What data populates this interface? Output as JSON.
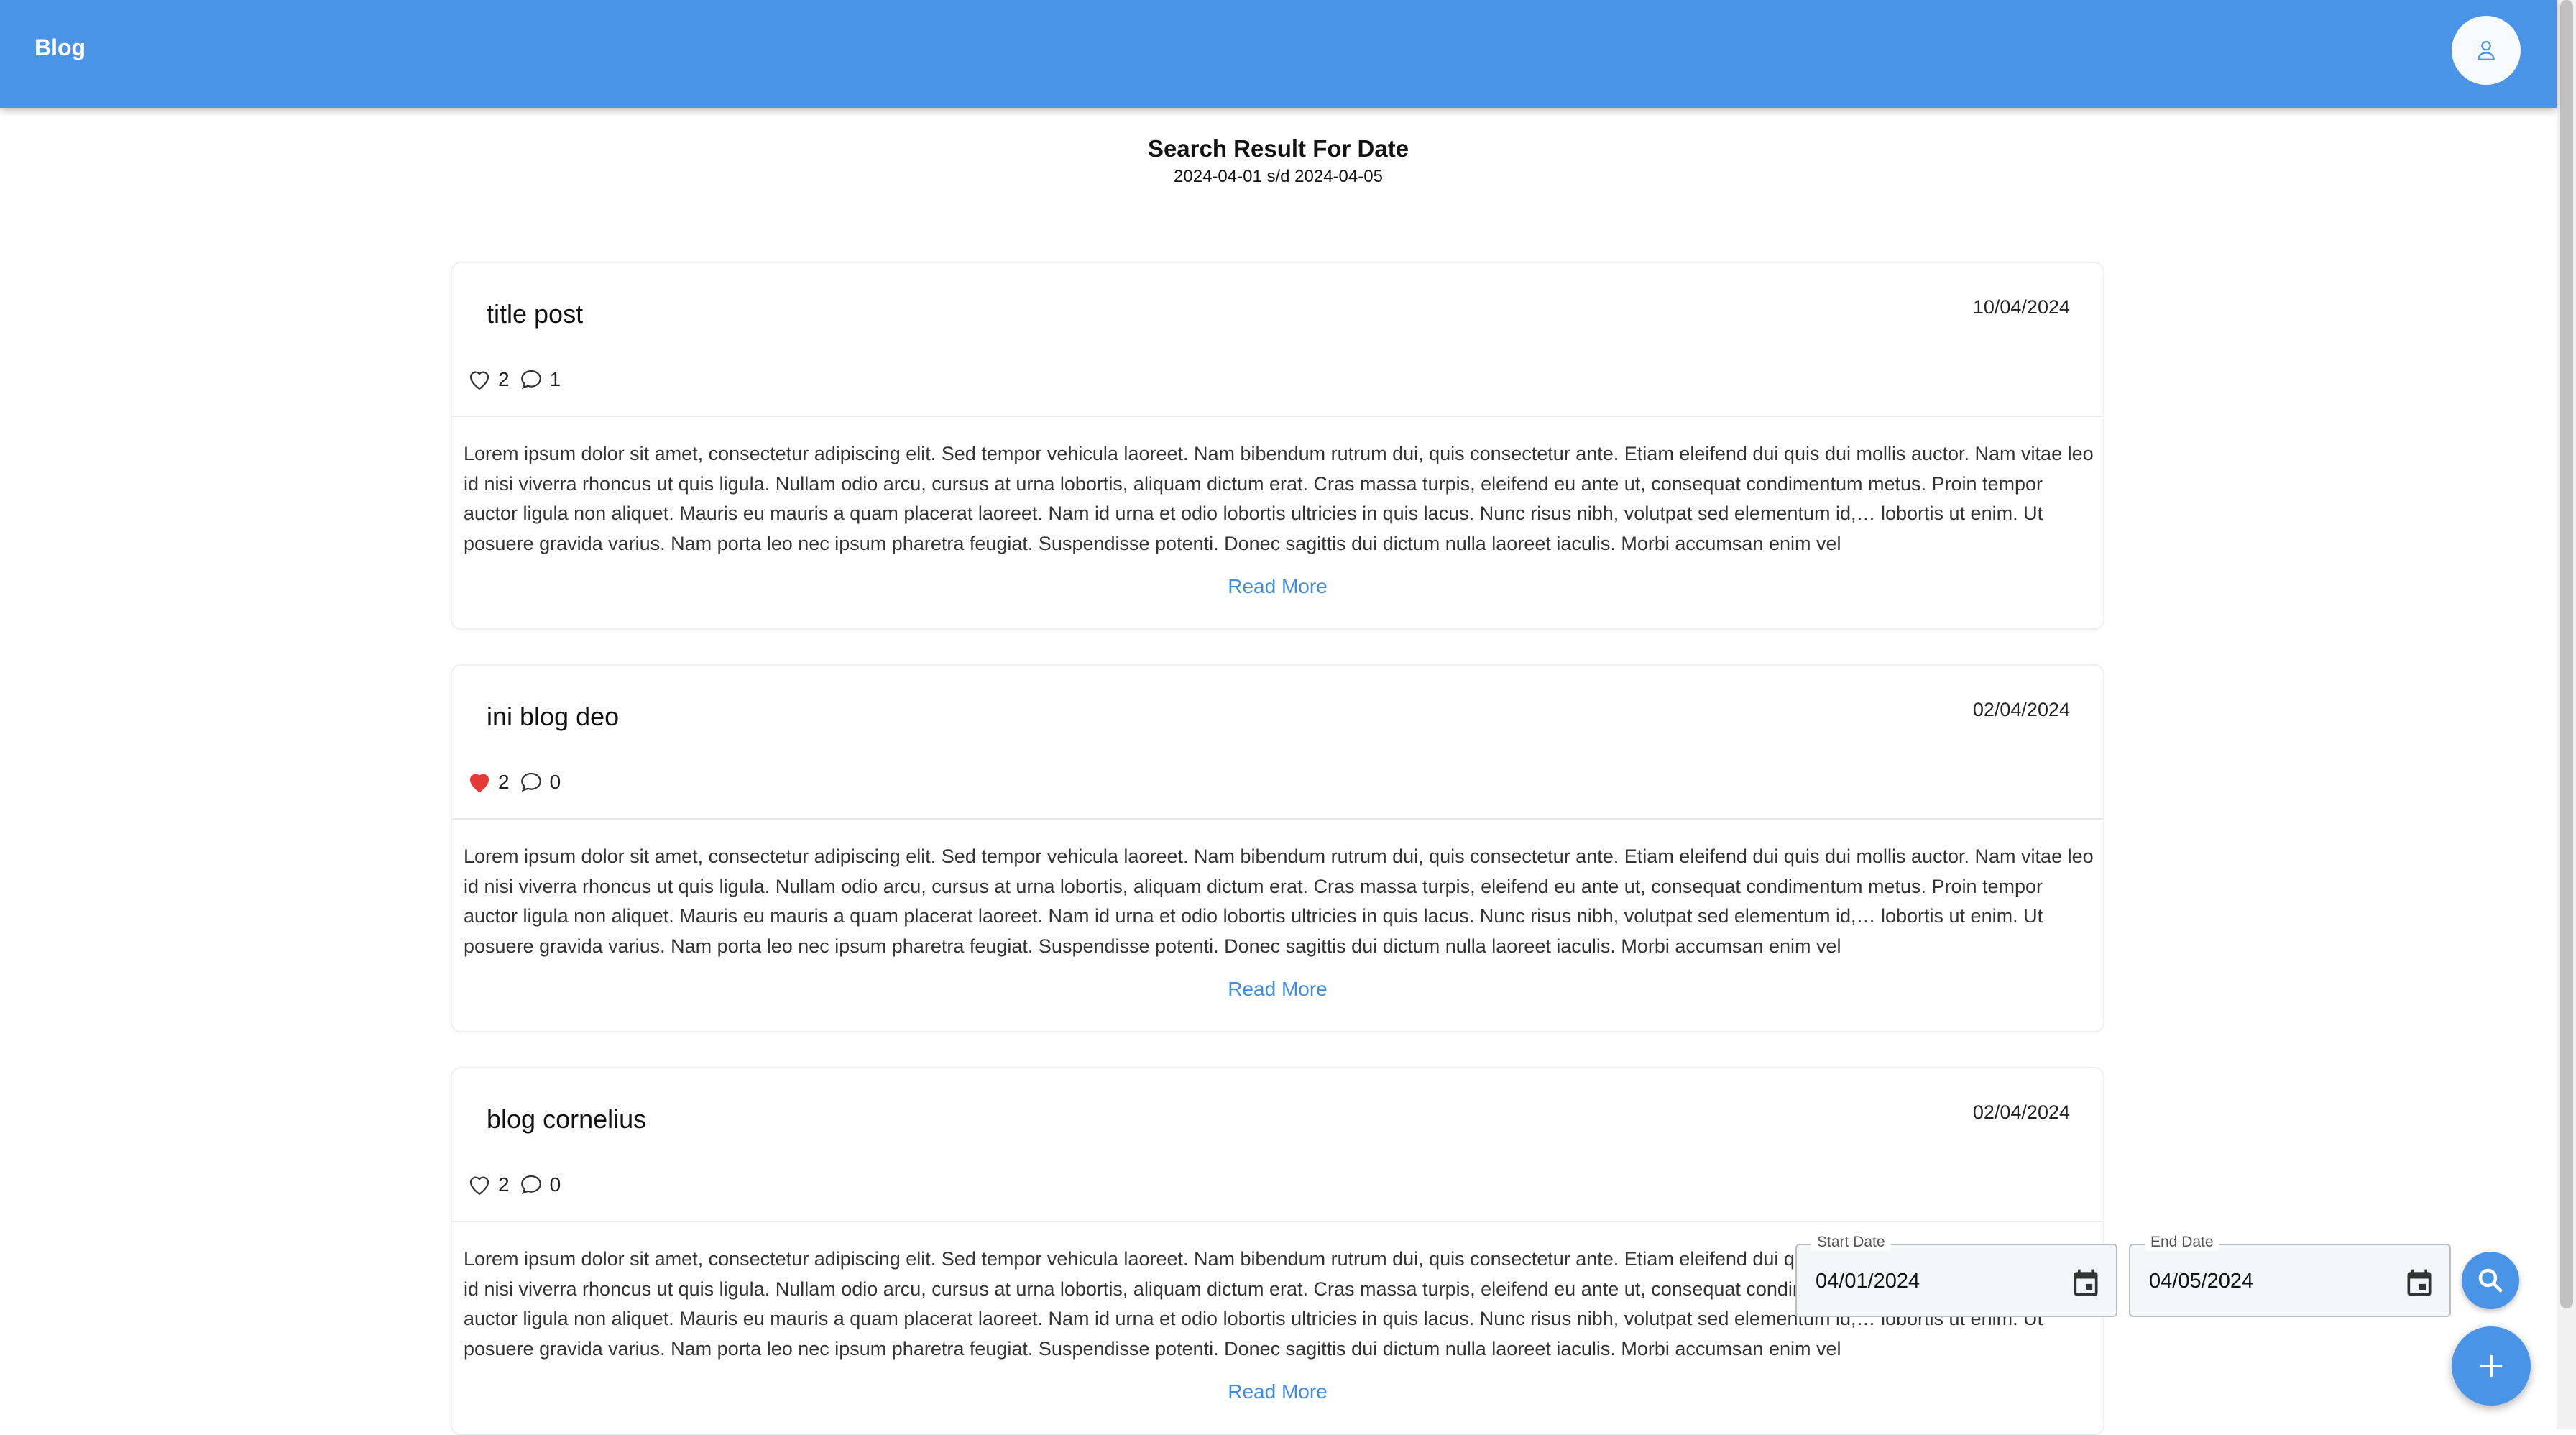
{
  "appbar": {
    "title": "Blog",
    "avatar_icon": "user-icon",
    "color": "#4a94e8"
  },
  "heading": {
    "title": "Search Result For Date",
    "range": "2024-04-01 s/d 2024-04-05"
  },
  "posts": [
    {
      "title": "title post",
      "date": "10/04/2024",
      "likes": "2",
      "liked": false,
      "comments": "1",
      "excerpt": "Lorem ipsum dolor sit amet, consectetur adipiscing elit. Sed tempor vehicula laoreet. Nam bibendum rutrum dui, quis consectetur ante. Etiam eleifend dui quis dui mollis auctor. Nam vitae leo id nisi viverra rhoncus ut quis ligula. Nullam odio arcu, cursus at urna lobortis, aliquam dictum erat. Cras massa turpis, eleifend eu ante ut, consequat condimentum metus. Proin tempor auctor ligula non aliquet. Mauris eu mauris a quam placerat laoreet. Nam id urna et odio lobortis ultricies in quis lacus. Nunc risus nibh, volutpat sed elementum id,… lobortis ut enim. Ut posuere gravida varius. Nam porta leo nec ipsum pharetra feugiat. Suspendisse potenti. Donec sagittis dui dictum nulla laoreet iaculis. Morbi accumsan enim vel",
      "read_more": "Read More"
    },
    {
      "title": "ini blog deo",
      "date": "02/04/2024",
      "likes": "2",
      "liked": true,
      "comments": "0",
      "excerpt": "Lorem ipsum dolor sit amet, consectetur adipiscing elit. Sed tempor vehicula laoreet. Nam bibendum rutrum dui, quis consectetur ante. Etiam eleifend dui quis dui mollis auctor. Nam vitae leo id nisi viverra rhoncus ut quis ligula. Nullam odio arcu, cursus at urna lobortis, aliquam dictum erat. Cras massa turpis, eleifend eu ante ut, consequat condimentum metus. Proin tempor auctor ligula non aliquet. Mauris eu mauris a quam placerat laoreet. Nam id urna et odio lobortis ultricies in quis lacus. Nunc risus nibh, volutpat sed elementum id,… lobortis ut enim. Ut posuere gravida varius. Nam porta leo nec ipsum pharetra feugiat. Suspendisse potenti. Donec sagittis dui dictum nulla laoreet iaculis. Morbi accumsan enim vel",
      "read_more": "Read More"
    },
    {
      "title": "blog cornelius",
      "date": "02/04/2024",
      "likes": "2",
      "liked": false,
      "comments": "0",
      "excerpt": "Lorem ipsum dolor sit amet, consectetur adipiscing elit. Sed tempor vehicula laoreet. Nam bibendum rutrum dui, quis consectetur ante. Etiam eleifend dui quis dui mollis auctor. Nam vitae leo id nisi viverra rhoncus ut quis ligula. Nullam odio arcu, cursus at urna lobortis, aliquam dictum erat. Cras massa turpis, eleifend eu ante ut, consequat condimentum metus. Proin tempor auctor ligula non aliquet. Mauris eu mauris a quam placerat laoreet. Nam id urna et odio lobortis ultricies in quis lacus. Nunc risus nibh, volutpat sed elementum id,… lobortis ut enim. Ut posuere gravida varius. Nam porta leo nec ipsum pharetra feugiat. Suspendisse potenti. Donec sagittis dui dictum nulla laoreet iaculis. Morbi accumsan enim vel",
      "read_more": "Read More"
    }
  ],
  "filter": {
    "start_label": "Start Date",
    "start_value": "04/01/2024",
    "end_label": "End Date",
    "end_value": "04/05/2024",
    "calendar_icon": "calendar-icon",
    "search_icon": "search-icon",
    "add_icon": "plus-icon"
  },
  "colors": {
    "accent": "#4a94e8",
    "link": "#3f8ee6",
    "liked_heart": "#e53935"
  }
}
